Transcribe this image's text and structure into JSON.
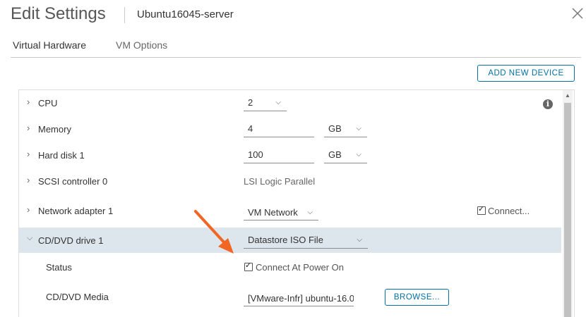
{
  "dialog": {
    "title": "Edit Settings",
    "vm_name": "Ubuntu16045-server",
    "close_glyph": "✕"
  },
  "tabs": [
    {
      "label": "Virtual Hardware",
      "active": true
    },
    {
      "label": "VM Options",
      "active": false
    }
  ],
  "toolbar": {
    "add_device_label": "ADD NEW DEVICE"
  },
  "hardware": {
    "cpu": {
      "label": "CPU",
      "value": "2"
    },
    "memory": {
      "label": "Memory",
      "value": "4",
      "unit": "GB"
    },
    "disk": {
      "label": "Hard disk 1",
      "value": "100",
      "unit": "GB"
    },
    "scsi": {
      "label": "SCSI controller 0",
      "value": "LSI Logic Parallel"
    },
    "network": {
      "label": "Network adapter 1",
      "value": "VM Network",
      "connect_label": "Connect...",
      "connected": true
    },
    "cdrom": {
      "label": "CD/DVD drive 1",
      "value": "Datastore ISO File",
      "status_label": "Status",
      "status_checkbox_label": "Connect At Power On",
      "status_checked": true,
      "media_label": "CD/DVD Media",
      "media_value": "[VMware-Infr] ubuntu-16.0",
      "browse_label": "BROWSE..."
    }
  },
  "icons": {
    "chevron_right": "›",
    "chevron_down": "⌵",
    "caret": "⌵",
    "info": "i"
  },
  "colors": {
    "accent": "#0072a3",
    "selected_row": "#dde5ed",
    "arrow": "#f26522"
  }
}
